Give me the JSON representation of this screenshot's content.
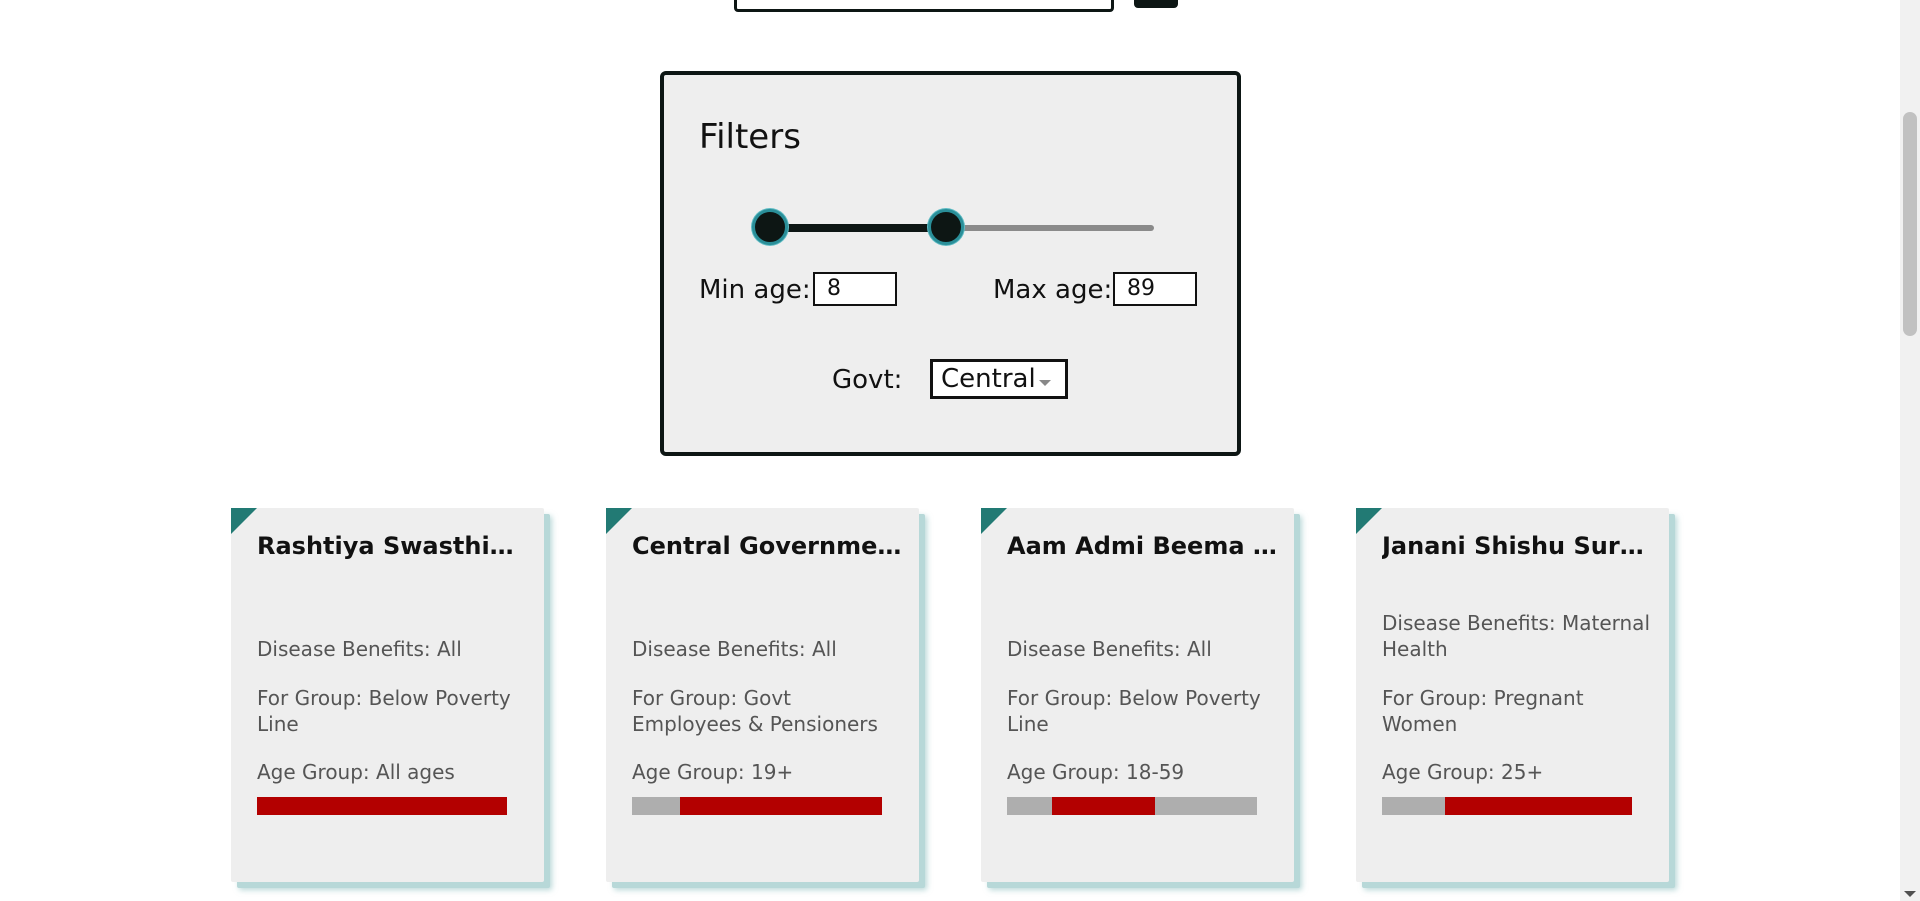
{
  "filters": {
    "title": "Filters",
    "min_age_label": "Min age:",
    "min_age_value": "8",
    "max_age_label": "Max age:",
    "max_age_value": "89",
    "govt_label": "Govt:",
    "govt_selected": "Central",
    "slider_range_pct": [
      4,
      48
    ]
  },
  "cards": [
    {
      "title": "Rashtiya Swasthiya Bima Yojana",
      "disease": "Disease Benefits: All",
      "group": "For Group: Below Poverty Line",
      "age_group": "Age Group: All ages",
      "age_bar_pct": [
        0,
        100
      ]
    },
    {
      "title": "Central Government Health Scheme",
      "disease": "Disease Benefits: All",
      "group": "For Group: Govt Employees & Pensioners",
      "age_group": "Age Group: 19+",
      "age_bar_pct": [
        19,
        100
      ]
    },
    {
      "title": "Aam Admi Beema Yojana",
      "disease": "Disease Benefits: All",
      "group": "For Group: Below Poverty Line",
      "age_group": "Age Group: 18-59",
      "age_bar_pct": [
        18,
        59
      ]
    },
    {
      "title": "Janani Shishu Suraksha Karyakram",
      "disease": "Disease Benefits: Maternal Health",
      "group": "For Group: Pregnant Women",
      "age_group": "Age Group: 25+",
      "age_bar_pct": [
        25,
        100
      ]
    }
  ],
  "colors": {
    "accent": "#0d1614",
    "teal": "#227a74",
    "bar_fill": "#b30000",
    "bar_track": "#aeaeae"
  }
}
